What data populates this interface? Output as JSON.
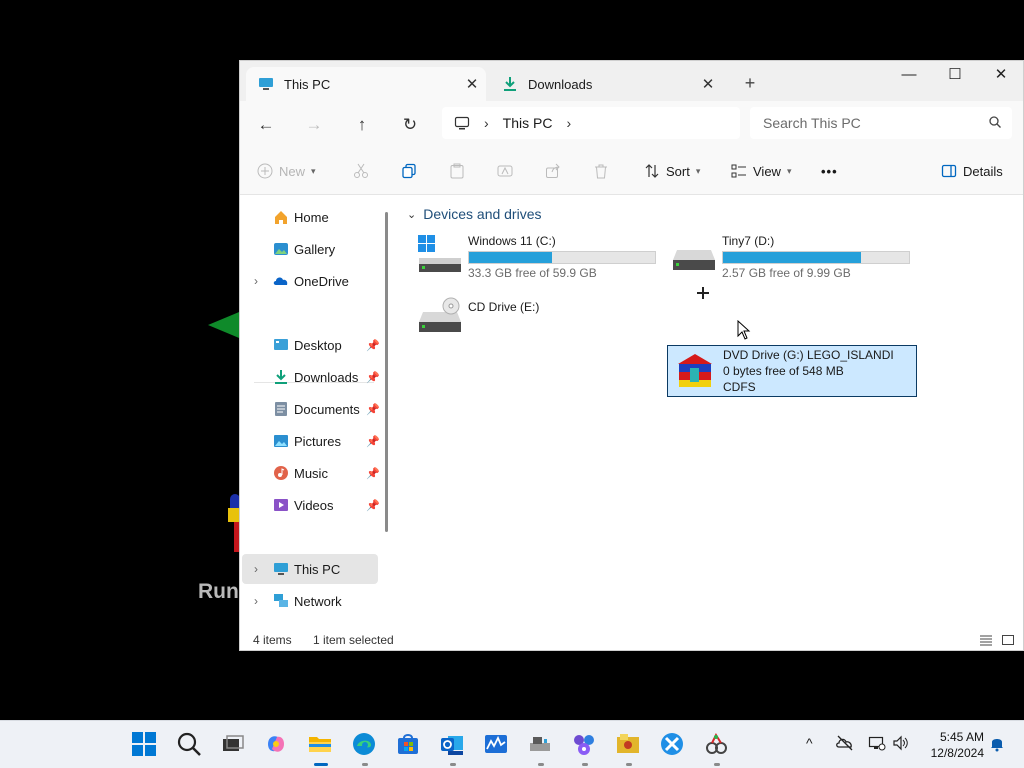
{
  "background": {
    "text": "Run"
  },
  "window": {
    "tabs": [
      {
        "label": "This PC",
        "active": true,
        "icon": "monitor-icon"
      },
      {
        "label": "Downloads",
        "active": false,
        "icon": "download-icon"
      }
    ],
    "new_tab": "+",
    "controls": {
      "minimize": "—",
      "maximize": "☐",
      "close": "✕"
    },
    "nav": {
      "back": "←",
      "forward": "→",
      "up": "↑",
      "refresh": "↻",
      "breadcrumb": [
        "This PC"
      ],
      "search_placeholder": "Search This PC"
    },
    "toolbar": {
      "new": "New",
      "sort": "Sort",
      "view": "View",
      "more": "•••",
      "details": "Details"
    },
    "sidebar": {
      "top": [
        {
          "label": "Home",
          "icon": "home-icon"
        },
        {
          "label": "Gallery",
          "icon": "gallery-icon"
        },
        {
          "label": "OneDrive",
          "icon": "onedrive-icon"
        }
      ],
      "quick": [
        {
          "label": "Desktop",
          "icon": "desktop-folder-icon"
        },
        {
          "label": "Downloads",
          "icon": "downloads-folder-icon"
        },
        {
          "label": "Documents",
          "icon": "documents-folder-icon"
        },
        {
          "label": "Pictures",
          "icon": "pictures-folder-icon"
        },
        {
          "label": "Music",
          "icon": "music-folder-icon"
        },
        {
          "label": "Videos",
          "icon": "videos-folder-icon"
        }
      ],
      "bottom": [
        {
          "label": "This PC",
          "icon": "this-pc-icon",
          "selected": true
        },
        {
          "label": "Network",
          "icon": "network-icon"
        }
      ]
    },
    "content": {
      "group_title": "Devices and drives",
      "drives": [
        {
          "name": "Windows 11 (C:)",
          "free_text": "33.3 GB free of 59.9 GB",
          "used_fraction": 0.444,
          "icon": "windows-drive-icon"
        },
        {
          "name": "Tiny7 (D:)",
          "free_text": "2.57 GB free of 9.99 GB",
          "used_fraction": 0.743,
          "icon": "hard-drive-icon"
        },
        {
          "name": "CD Drive (E:)",
          "icon": "cd-drive-icon"
        },
        {
          "name": "DVD Drive (G:) LEGO_ISLANDI",
          "free_text": "0 bytes free of 548 MB",
          "filesystem": "CDFS",
          "icon": "lego-island-disc-icon",
          "selected": true
        }
      ]
    },
    "status": {
      "count": "4 items",
      "selection": "1 item selected"
    }
  },
  "taskbar": {
    "clock": {
      "time": "5:45 AM",
      "date": "12/8/2024"
    },
    "apps": [
      "start-icon",
      "search-icon",
      "task-view-icon",
      "copilot-icon",
      "file-explorer-icon",
      "edge-icon",
      "store-icon",
      "outlook-icon",
      "task-manager-icon",
      "network-tool-icon",
      "media-app-icon",
      "game-icon",
      "app-icon",
      "paint-icon"
    ],
    "tray": {
      "chevron": "^"
    }
  },
  "colors": {
    "accent": "#0067c0",
    "selection": "#cce8ff",
    "bar_fill": "#26a0da"
  }
}
